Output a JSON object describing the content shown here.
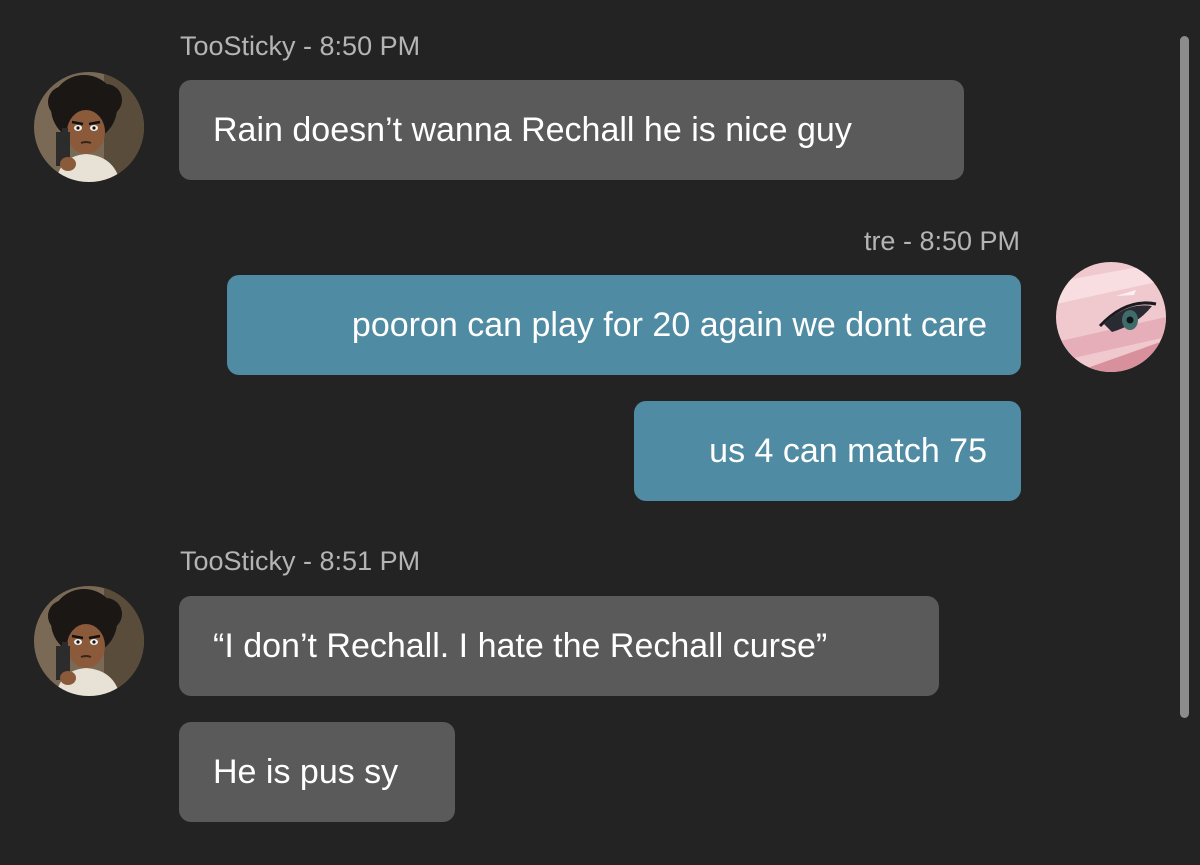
{
  "messages": [
    {
      "header": "TooSticky - 8:50 PM",
      "texts": [
        "Rain doesn’t wanna Rechall he is nice guy"
      ]
    },
    {
      "header": "tre - 8:50 PM",
      "texts": [
        "pooron can play for 20 again we dont care",
        "us 4 can match 75"
      ]
    },
    {
      "header": "TooSticky - 8:51 PM",
      "texts": [
        "“I don’t Rechall. I hate the Rechall curse”",
        "He is pus sy"
      ]
    }
  ],
  "colors": {
    "background": "#232323",
    "incoming_bubble": "#5a5a5a",
    "outgoing_bubble": "#4f8ba2",
    "header_text": "#b4b4b4",
    "message_text": "#ffffff"
  },
  "icons": {
    "avatar_toosticky": "cartoon-boy-avatar-icon",
    "avatar_tre": "pink-anime-eye-avatar-icon"
  }
}
